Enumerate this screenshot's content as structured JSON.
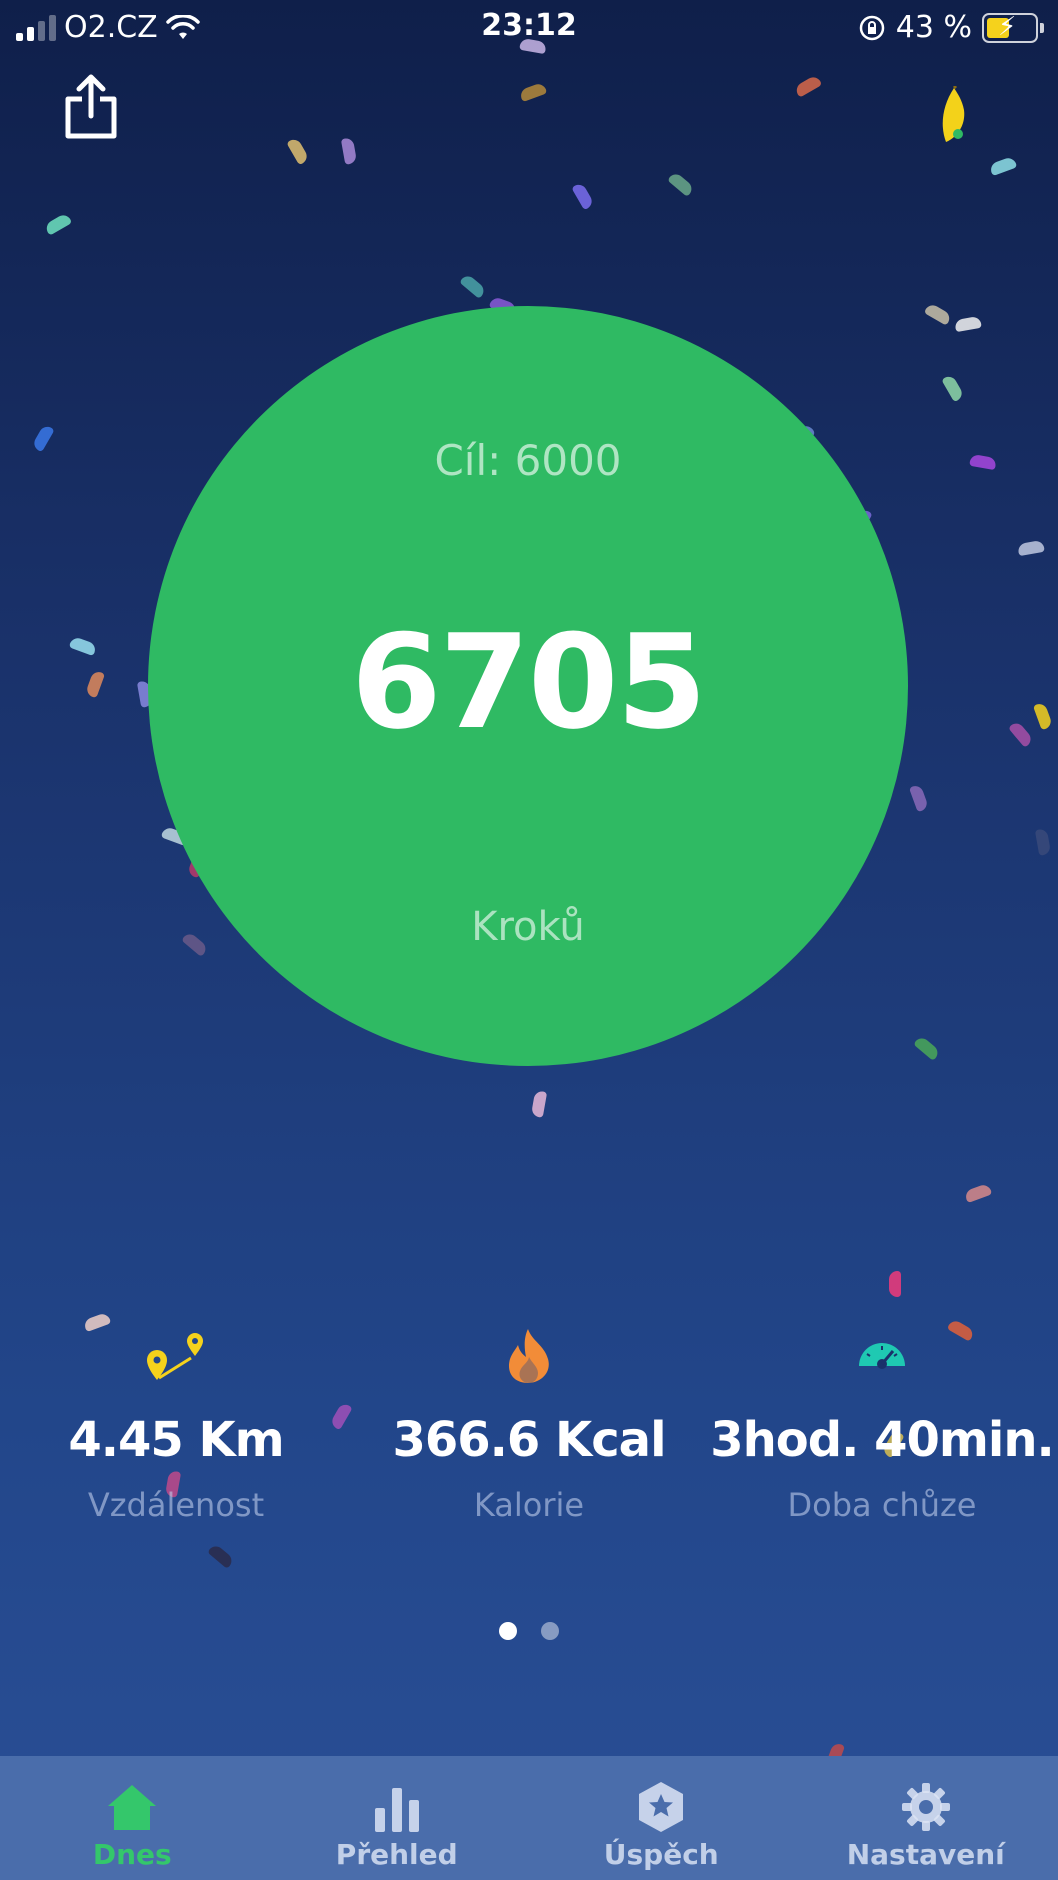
{
  "status_bar": {
    "carrier": "O2.CZ",
    "time": "23:12",
    "battery": "43 %",
    "icons": [
      "signal-icon",
      "wifi-icon",
      "rotation-lock-icon",
      "battery-charging-icon"
    ]
  },
  "header": {
    "share_icon": "share-icon",
    "mascot_icon": "banana-icon"
  },
  "steps": {
    "goal": "Cíl: 6000",
    "count": "6705",
    "unit": "Kroků"
  },
  "stats": [
    {
      "icon": "route-pins-icon",
      "value": "4.45 Km",
      "label": "Vzdálenost"
    },
    {
      "icon": "flame-icon",
      "value": "366.6 Kcal",
      "label": "Kalorie"
    },
    {
      "icon": "speedometer-icon",
      "value": "3hod. 40min.",
      "label": "Doba chůze"
    }
  ],
  "pager": {
    "pages": 2,
    "active": 1
  },
  "tabs": [
    {
      "label": "Dnes",
      "icon": "home-icon",
      "active": true
    },
    {
      "label": "Přehled",
      "icon": "bar-chart-icon",
      "active": false
    },
    {
      "label": "Úspěch",
      "icon": "achievement-star-icon",
      "active": false
    },
    {
      "label": "Nastavení",
      "icon": "gear-icon",
      "active": false
    }
  ],
  "colors": {
    "accent_green": "#2fba63",
    "tab_active": "#34c76b",
    "tab_bar": "#4a6dab",
    "pin_yellow": "#f5d21c",
    "flame_orange": "#f28c38",
    "gauge_teal": "#1fc9b2"
  }
}
